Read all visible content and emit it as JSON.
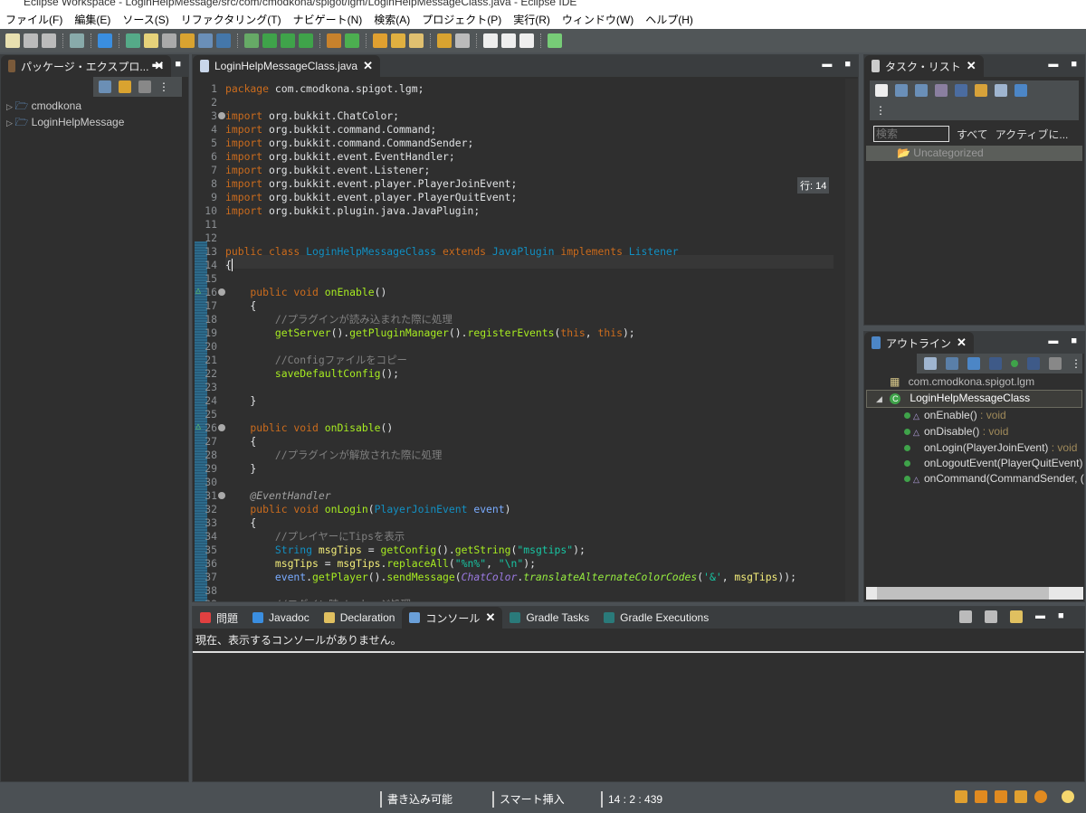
{
  "window": {
    "title": "Eclipse Workspace - LoginHelpMessage/src/com/cmodkona/spigot/lgm/LoginHelpMessageClass.java - Eclipse IDE"
  },
  "menu": [
    "ファイル(F)",
    "編集(E)",
    "ソース(S)",
    "リファクタリング(T)",
    "ナビゲート(N)",
    "検索(A)",
    "プロジェクト(P)",
    "実行(R)",
    "ウィンドウ(W)",
    "ヘルプ(H)"
  ],
  "package_explorer": {
    "tab": "パッケージ・エクスプロ...",
    "items": [
      "cmodkona",
      "LoginHelpMessage"
    ]
  },
  "editor": {
    "tab": "LoginHelpMessageClass.java",
    "line_tooltip": "行: 14",
    "lines": [
      [
        [
          "kw",
          "package"
        ],
        [
          "tx",
          " com.cmodkona.spigot.lgm;"
        ]
      ],
      [],
      [
        [
          "kw",
          "import"
        ],
        [
          "tx",
          " org.bukkit.ChatColor;"
        ]
      ],
      [
        [
          "kw",
          "import"
        ],
        [
          "tx",
          " org.bukkit.command.Command;"
        ]
      ],
      [
        [
          "kw",
          "import"
        ],
        [
          "tx",
          " org.bukkit.command.CommandSender;"
        ]
      ],
      [
        [
          "kw",
          "import"
        ],
        [
          "tx",
          " org.bukkit.event.EventHandler;"
        ]
      ],
      [
        [
          "kw",
          "import"
        ],
        [
          "tx",
          " org.bukkit.event.Listener;"
        ]
      ],
      [
        [
          "kw",
          "import"
        ],
        [
          "tx",
          " org.bukkit.event.player.PlayerJoinEvent;"
        ]
      ],
      [
        [
          "kw",
          "import"
        ],
        [
          "tx",
          " org.bukkit.event.player.PlayerQuitEvent;"
        ]
      ],
      [
        [
          "kw",
          "import"
        ],
        [
          "tx",
          " org.bukkit.plugin.java.JavaPlugin;"
        ]
      ],
      [],
      [],
      [
        [
          "kw",
          "public class "
        ],
        [
          "ty",
          "LoginHelpMessageClass "
        ],
        [
          "kw",
          "extends "
        ],
        [
          "ty",
          "JavaPlugin "
        ],
        [
          "kw",
          "implements "
        ],
        [
          "ty",
          "Listener"
        ]
      ],
      [
        [
          "tx",
          "{"
        ]
      ],
      [],
      [
        [
          "kw",
          "    public void "
        ],
        [
          "me",
          "onEnable"
        ],
        [
          "tx",
          "()"
        ]
      ],
      [
        [
          "tx",
          "    {"
        ]
      ],
      [
        [
          "cm",
          "        //プラグインが読み込まれた際に処理"
        ]
      ],
      [
        [
          "me",
          "        getServer"
        ],
        [
          "tx",
          "()."
        ],
        [
          "me",
          "getPluginManager"
        ],
        [
          "tx",
          "()."
        ],
        [
          "me",
          "registerEvents"
        ],
        [
          "tx",
          "("
        ],
        [
          "kw",
          "this"
        ],
        [
          "tx",
          ", "
        ],
        [
          "kw",
          "this"
        ],
        [
          "tx",
          ");"
        ]
      ],
      [],
      [
        [
          "cm",
          "        //Configファイルをコピー"
        ]
      ],
      [
        [
          "me",
          "        saveDefaultConfig"
        ],
        [
          "tx",
          "();"
        ]
      ],
      [],
      [
        [
          "tx",
          "    }"
        ]
      ],
      [],
      [
        [
          "kw",
          "    public void "
        ],
        [
          "me",
          "onDisable"
        ],
        [
          "tx",
          "()"
        ]
      ],
      [
        [
          "tx",
          "    {"
        ]
      ],
      [
        [
          "cm",
          "        //プラグインが解放された際に処理"
        ]
      ],
      [
        [
          "tx",
          "    }"
        ]
      ],
      [],
      [
        [
          "an",
          "    @EventHandler"
        ]
      ],
      [
        [
          "kw",
          "    public void "
        ],
        [
          "me",
          "onLogin"
        ],
        [
          "tx",
          "("
        ],
        [
          "ty",
          "PlayerJoinEvent "
        ],
        [
          "pa",
          "event"
        ],
        [
          "tx",
          ")"
        ]
      ],
      [
        [
          "tx",
          "    {"
        ]
      ],
      [
        [
          "cm",
          "        //プレイヤーにTipsを表示"
        ]
      ],
      [
        [
          "ty",
          "        String "
        ],
        [
          "va",
          "msgTips"
        ],
        [
          "tx",
          " = "
        ],
        [
          "me",
          "getConfig"
        ],
        [
          "tx",
          "()."
        ],
        [
          "me",
          "getString"
        ],
        [
          "tx",
          "("
        ],
        [
          "st",
          "\"msgtips\""
        ],
        [
          "tx",
          ");"
        ]
      ],
      [
        [
          "va",
          "        msgTips"
        ],
        [
          "tx",
          " = "
        ],
        [
          "va",
          "msgTips"
        ],
        [
          "tx",
          "."
        ],
        [
          "me",
          "replaceAll"
        ],
        [
          "tx",
          "("
        ],
        [
          "st",
          "\"%n%\""
        ],
        [
          "tx",
          ", "
        ],
        [
          "st",
          "\"\\n\""
        ],
        [
          "tx",
          ");"
        ]
      ],
      [
        [
          "pa",
          "        event"
        ],
        [
          "tx",
          "."
        ],
        [
          "me",
          "getPlayer"
        ],
        [
          "tx",
          "()."
        ],
        [
          "me",
          "sendMessage"
        ],
        [
          "tx",
          "("
        ],
        [
          "sc",
          "ChatColor"
        ],
        [
          "tx",
          "."
        ],
        [
          "sm",
          "translateAlternateColorCodes"
        ],
        [
          "tx",
          "("
        ],
        [
          "st",
          "'&'"
        ],
        [
          "tx",
          ", "
        ],
        [
          "va",
          "msgTips"
        ],
        [
          "tx",
          "));"
        ]
      ],
      [],
      [
        [
          "cm",
          "        //ログイン時メッセージ処理"
        ]
      ]
    ]
  },
  "task_list": {
    "tab": "タスク・リスト",
    "search_placeholder": "検索",
    "filter_all": "すべて",
    "filter_active": "アクティブに...",
    "category": "Uncategorized"
  },
  "outline": {
    "tab": "アウトライン",
    "package": "com.cmodkona.spigot.lgm",
    "class": "LoginHelpMessageClass",
    "members": [
      {
        "name": "onEnable()",
        "type": " : void",
        "override": true
      },
      {
        "name": "onDisable()",
        "type": " : void",
        "override": true
      },
      {
        "name": "onLogin(PlayerJoinEvent)",
        "type": " : void",
        "override": false
      },
      {
        "name": "onLogoutEvent(PlayerQuitEvent)",
        "type": "",
        "override": false
      },
      {
        "name": "onCommand(CommandSender, (",
        "type": "",
        "override": true
      }
    ]
  },
  "bottom": {
    "tabs": [
      "問題",
      "Javadoc",
      "Declaration",
      "コンソール",
      "Gradle Tasks",
      "Gradle Executions"
    ],
    "active": "コンソール",
    "message": "現在、表示するコンソールがありません。"
  },
  "status": {
    "writable": "書き込み可能",
    "insert_mode": "スマート挿入",
    "position": "14 : 2 : 439"
  }
}
